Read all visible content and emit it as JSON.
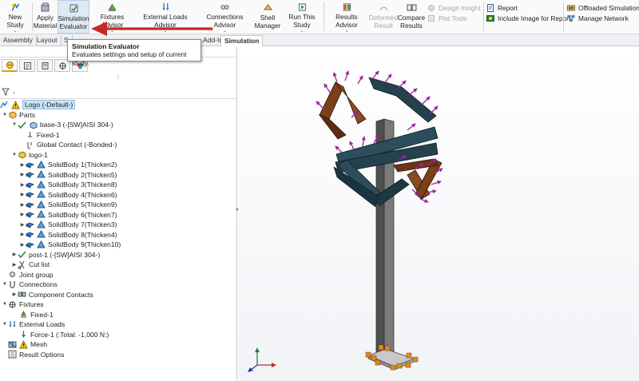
{
  "ribbon": {
    "new_study": "New Study",
    "apply_material": "Apply\nMaterial",
    "simulation_evaluator": "Simulation\nEvaluator",
    "fixtures_advisor": "Fixtures Advisor",
    "external_loads_advisor": "External Loads Advisor",
    "connections_advisor": "Connections Advisor",
    "shell_manager": "Shell\nManager",
    "run_this_study": "Run This Study",
    "results_advisor": "Results Advisor",
    "deformed_result": "Deformed\nResult",
    "compare_results": "Compare\nResults",
    "design_insight": "Design Insight",
    "plot_tools": "Plot Tools",
    "report": "Report",
    "include_image": "Include Image for Report",
    "offloaded_simulation": "Offloaded Simulation",
    "manage_network": "Manage Network"
  },
  "tabs": [
    {
      "label": "Assembly"
    },
    {
      "label": "Layout"
    },
    {
      "label": "S"
    },
    {
      "label": "Add-Ins"
    },
    {
      "label": "Simulation"
    }
  ],
  "tooltip": {
    "title": "Simulation Evaluator",
    "description": "Evaluates settings and setup of current study."
  },
  "tree": {
    "root": "Logo (-Default-)",
    "parts": "Parts",
    "base": "base-3 (-[SW]AISI 304-)",
    "fixed_1a": "Fixed-1",
    "global_contact": "Global Contact (-Bonded-)",
    "logo": "logo-1",
    "bodies": [
      "SolidBody 1(Thicken2)",
      "SolidBody 2(Thicken5)",
      "SolidBody 3(Thicken8)",
      "SolidBody 4(Thicken6)",
      "SolidBody 5(Thicken9)",
      "SolidBody 6(Thicken7)",
      "SolidBody 7(Thicken3)",
      "SolidBody 8(Thicken4)",
      "SolidBody 9(Thicken10)"
    ],
    "post": "post-1 (-[SW]AISI 304-)",
    "cut_list": "Cut list",
    "joint_group": "Joint group",
    "connections": "Connections",
    "component_contacts": "Component Contacts",
    "fixtures": "Fixtures",
    "fixed_1b": "Fixed-1",
    "external_loads": "External Loads",
    "force": "Force-1 (:Total: -1,000 N:)",
    "mesh": "Mesh",
    "result_options": "Result Options"
  },
  "colors": {
    "accent": "#c62828",
    "selection": "#cce4f7",
    "model_teal": "#24414d",
    "model_brown": "#7a3f1b",
    "load_arrows": "#a020a0",
    "fixture": "#e08a1e"
  }
}
